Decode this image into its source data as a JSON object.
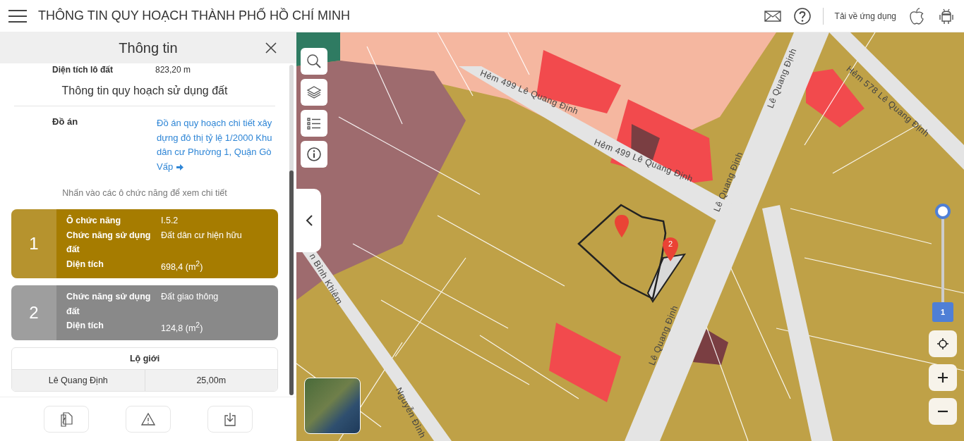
{
  "header": {
    "title": "THÔNG TIN QUY HOẠCH THÀNH PHỐ HỒ CHÍ MINH",
    "download_label": "Tải về ứng dụng"
  },
  "panel": {
    "title": "Thông tin",
    "info_row": {
      "label": "Diện tích lô đất",
      "value": "823,20 m"
    },
    "section_title": "Thông tin quy hoạch sử dụng đất",
    "plan": {
      "label": "Đồ án",
      "link": "Đồ án quy hoạch chi tiết xây dựng đô thị tỷ lệ 1/2000 Khu dân cư Phường 1, Quận Gò Vấp"
    },
    "hint": "Nhấn vào các ô chức năng để xem chi tiết",
    "zones": [
      {
        "number": "1",
        "color": "#a67c00",
        "rows": [
          {
            "label": "Ô chức năng",
            "value": "I.5.2"
          },
          {
            "label": "Chức năng sử dụng đất",
            "value": "Đất dân cư hiện hữu"
          },
          {
            "label": "Diện tích",
            "value": "698,4 (m$^{2}$)"
          }
        ]
      },
      {
        "number": "2",
        "color": "#898989",
        "rows": [
          {
            "label": "Chức năng sử dụng đất",
            "value": "Đất giao thông"
          },
          {
            "label": "Diện tích",
            "value": "124,8 (m$^{2}$)"
          }
        ]
      }
    ],
    "road_width": {
      "title": "Lộ giới",
      "rows": [
        {
          "name": "Lê Quang Định",
          "width": "25,00m"
        }
      ]
    }
  },
  "map": {
    "labels": [
      {
        "text": "Hẻm 499 Lê Quang Định"
      },
      {
        "text": "Hẻm 499 Lê Quang Định"
      },
      {
        "text": "Lê Quang Định"
      },
      {
        "text": "Lê Quang Định"
      },
      {
        "text": "Lê Quang Định"
      },
      {
        "text": "Hẻm 578 Lê Quang Định"
      },
      {
        "text": "n Bình Khiêm"
      },
      {
        "text": "Nguyễn Đình"
      }
    ],
    "markers": [
      {
        "kind": "pin"
      },
      {
        "kind": "numbered",
        "label": "2"
      }
    ],
    "layer_slider": {
      "level": 1,
      "label": "1"
    }
  }
}
